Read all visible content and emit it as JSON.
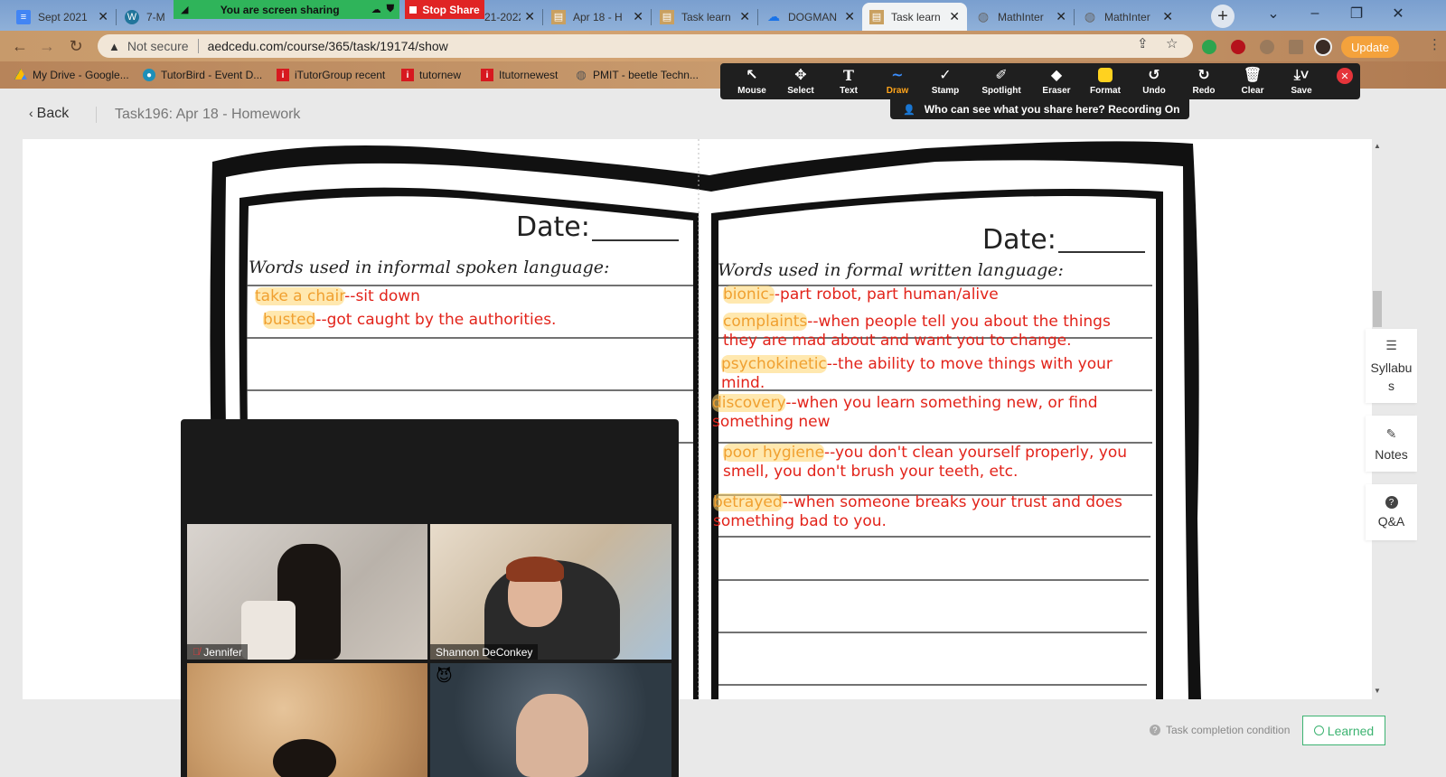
{
  "browser": {
    "tabs": [
      {
        "title": "Sept 2021",
        "favicon": "docs-icon",
        "color": "#4285f4"
      },
      {
        "title": "7-M",
        "favicon": "wordpress-icon",
        "color": "#21759b"
      },
      {
        "title": "21-2022",
        "favicon": "sheets-icon",
        "color": "#0f9d58"
      },
      {
        "title": "Apr 18 - H",
        "favicon": "doc-icon",
        "color": "#c9a060"
      },
      {
        "title": "Task learn",
        "favicon": "doc-icon",
        "color": "#c9a060"
      },
      {
        "title": "DOGMAN",
        "favicon": "cloud-icon",
        "color": "#1a73e8"
      },
      {
        "title": "Task learn",
        "favicon": "doc-icon",
        "color": "#c9a060"
      },
      {
        "title": "MathInter",
        "favicon": "globe-icon",
        "color": "#777777"
      },
      {
        "title": "MathInter",
        "favicon": "globe-icon",
        "color": "#777777"
      }
    ],
    "sharing_label": "You are screen sharing",
    "stop_share_label": "Stop Share",
    "not_secure": "Not secure",
    "url": "aedcedu.com/course/365/task/19174/show",
    "update_label": "Update",
    "bookmarks": [
      {
        "label": "My Drive - Google...",
        "icon": "drive-icon"
      },
      {
        "label": "TutorBird - Event D...",
        "icon": "tutorbird-icon"
      },
      {
        "label": "iTutorGroup recent",
        "icon": "itutor-icon"
      },
      {
        "label": "tutornew",
        "icon": "itutor-icon"
      },
      {
        "label": "Itutornewest",
        "icon": "itutor-icon"
      },
      {
        "label": "PMIT - beetle Techn...",
        "icon": "globe-icon"
      }
    ]
  },
  "annotate": {
    "tools": [
      {
        "label": "Mouse",
        "icon": "mouse-icon"
      },
      {
        "label": "Select",
        "icon": "select-icon"
      },
      {
        "label": "Text",
        "icon": "text-icon"
      },
      {
        "label": "Draw",
        "icon": "draw-icon",
        "active": true
      },
      {
        "label": "Stamp",
        "icon": "stamp-icon"
      },
      {
        "label": "Spotlight",
        "icon": "spotlight-icon"
      },
      {
        "label": "Eraser",
        "icon": "eraser-icon"
      },
      {
        "label": "Format",
        "icon": "format-icon"
      },
      {
        "label": "Undo",
        "icon": "undo-icon"
      },
      {
        "label": "Redo",
        "icon": "redo-icon"
      },
      {
        "label": "Clear",
        "icon": "trash-icon"
      },
      {
        "label": "Save",
        "icon": "save-icon"
      }
    ],
    "recording_notice": "Who can see what you share here? Recording On"
  },
  "page": {
    "back_label": "Back",
    "title": "Task196:  Apr 18 - Homework"
  },
  "worksheet": {
    "date_label": "Date:",
    "informal_header": "Words used in informal spoken language:",
    "formal_header": "Words used in formal written language:",
    "informal_entries": [
      {
        "term": "take a chair",
        "def": "--sit down"
      },
      {
        "term": "busted",
        "def": "--got caught by the authorities."
      }
    ],
    "formal_entries": [
      {
        "term": "bionic-",
        "def": "-part robot, part human/alive"
      },
      {
        "term": "complaints",
        "def": "--when people tell you about the things they are mad about and want you to change."
      },
      {
        "term": "psychokinetic",
        "def": "--the ability to move things with your mind."
      },
      {
        "term": "discovery",
        "def": "--when you learn something new, or find something new"
      },
      {
        "term": "poor hygiene",
        "def": "--you don't clean yourself properly, you smell, you don't brush your teeth, etc."
      },
      {
        "term": "betrayed",
        "def": "--when someone breaks your trust and does something bad to you."
      }
    ],
    "highlight_color": "#ffd66e",
    "ink_color": "#e2231a"
  },
  "sidebar": {
    "syllabus": "Syllabu s",
    "notes": "Notes",
    "qa": "Q&A"
  },
  "footer": {
    "task_condition": "Task completion condition",
    "learned_label": "Learned"
  },
  "video": {
    "participants": [
      {
        "name": "Jennifer",
        "muted": true
      },
      {
        "name": "Shannon DeConkey",
        "muted": false
      },
      {
        "name": "",
        "muted": false
      },
      {
        "name": "",
        "muted": false,
        "emoji": "😈"
      }
    ]
  }
}
